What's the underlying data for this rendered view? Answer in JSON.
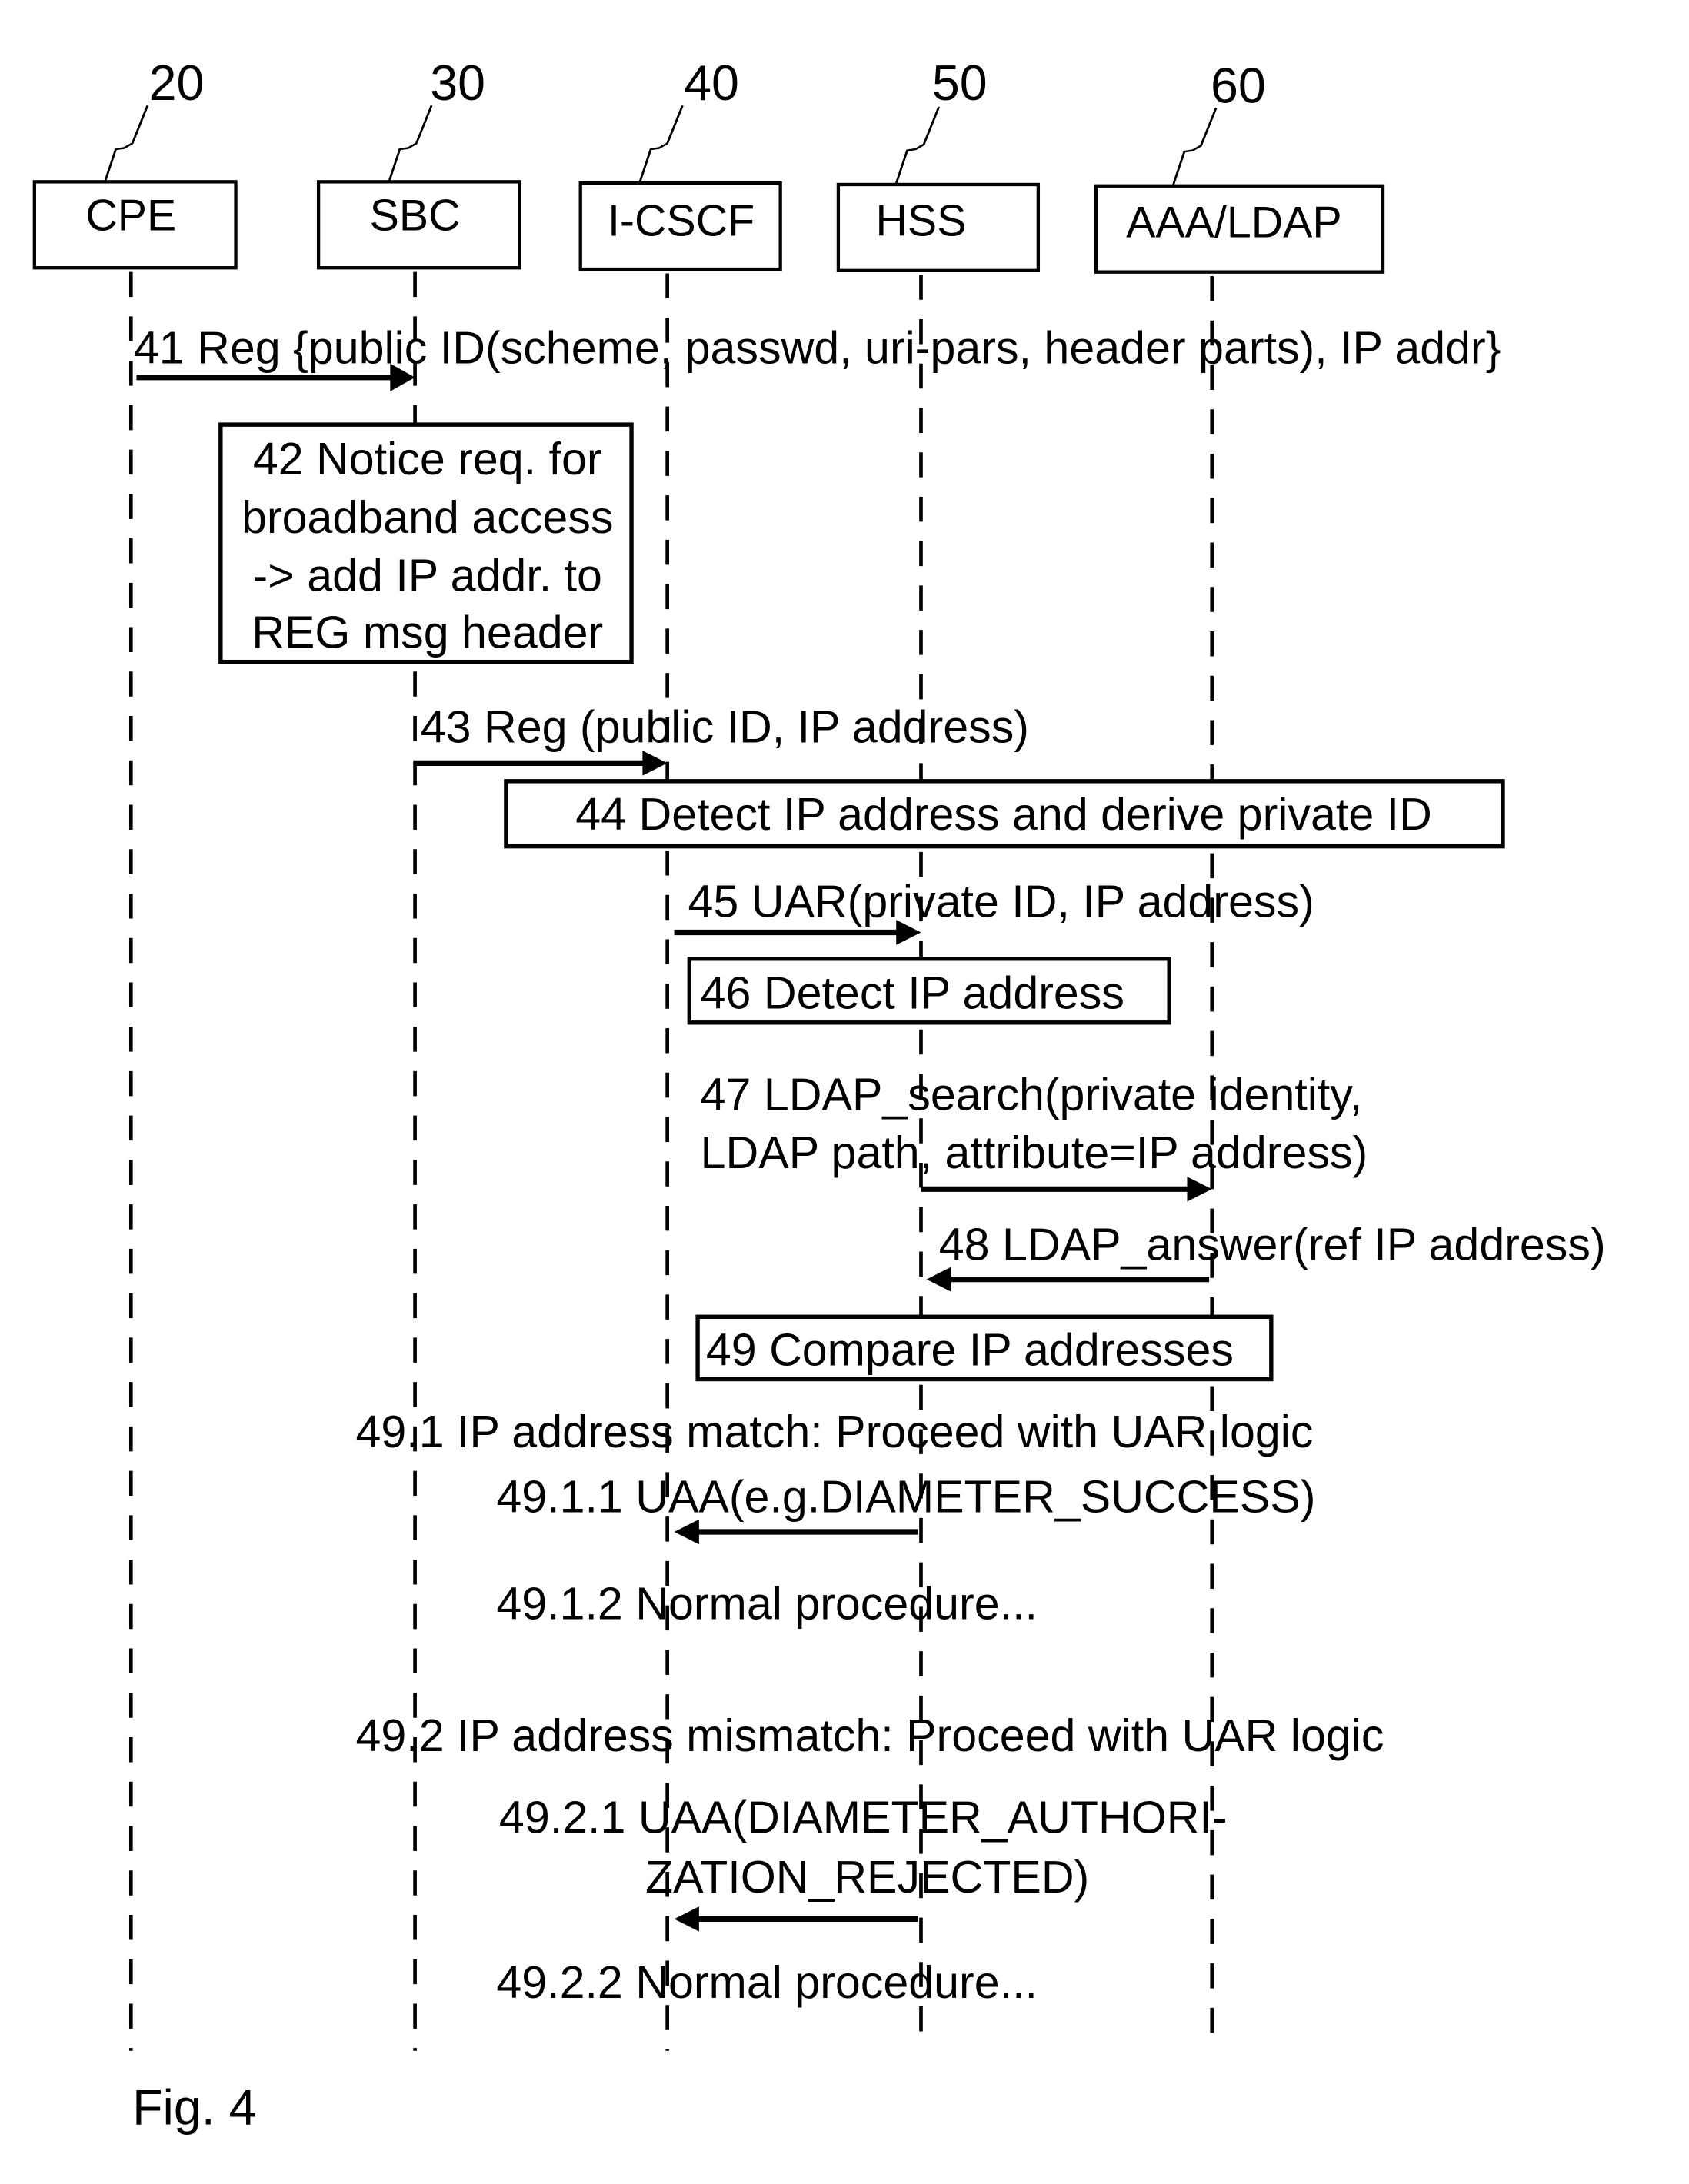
{
  "figure_label": "Fig. 4",
  "entities": [
    {
      "ref": "20",
      "name": "CPE"
    },
    {
      "ref": "30",
      "name": "SBC"
    },
    {
      "ref": "40",
      "name": "I-CSCF"
    },
    {
      "ref": "50",
      "name": "HSS"
    },
    {
      "ref": "60",
      "name": "AAA/LDAP"
    }
  ],
  "steps": {
    "s41": {
      "text": "41 Reg {public ID(scheme, passwd, uri-pars, header parts), IP addr}",
      "from": "CPE",
      "to": "SBC"
    },
    "s42": {
      "lines": [
        "42 Notice req. for",
        "broadband access",
        "-> add IP addr. to",
        "REG msg header"
      ],
      "at": "SBC"
    },
    "s43": {
      "text": "43 Reg (public ID, IP address)",
      "from": "SBC",
      "to": "I-CSCF"
    },
    "s44": {
      "text": "44 Detect IP address and derive private ID",
      "at": "I-CSCF"
    },
    "s45": {
      "text": "45 UAR(private ID, IP address)",
      "from": "I-CSCF",
      "to": "HSS"
    },
    "s46": {
      "text": "46 Detect IP address",
      "at": "HSS"
    },
    "s47": {
      "lines": [
        "47 LDAP_search(private identity,",
        "LDAP path, attribute=IP address)"
      ],
      "from": "HSS",
      "to": "AAA/LDAP"
    },
    "s48": {
      "text": "48 LDAP_answer(ref IP address)",
      "from": "AAA/LDAP",
      "to": "HSS"
    },
    "s49": {
      "text": "49 Compare IP addresses",
      "at": "HSS"
    },
    "s49_1": {
      "text": "49.1 IP address match: Proceed with UAR logic"
    },
    "s49_1_1": {
      "text": "49.1.1 UAA(e.g.DIAMETER_SUCCESS)",
      "from": "HSS",
      "to": "I-CSCF"
    },
    "s49_1_2": {
      "text": "49.1.2 Normal procedure..."
    },
    "s49_2": {
      "text": "49.2 IP address mismatch: Proceed with UAR logic"
    },
    "s49_2_1": {
      "lines": [
        "49.2.1 UAA(DIAMETER_AUTHORI-",
        "ZATION_REJECTED)"
      ],
      "from": "HSS",
      "to": "I-CSCF"
    },
    "s49_2_2": {
      "text": "49.2.2 Normal procedure..."
    }
  }
}
